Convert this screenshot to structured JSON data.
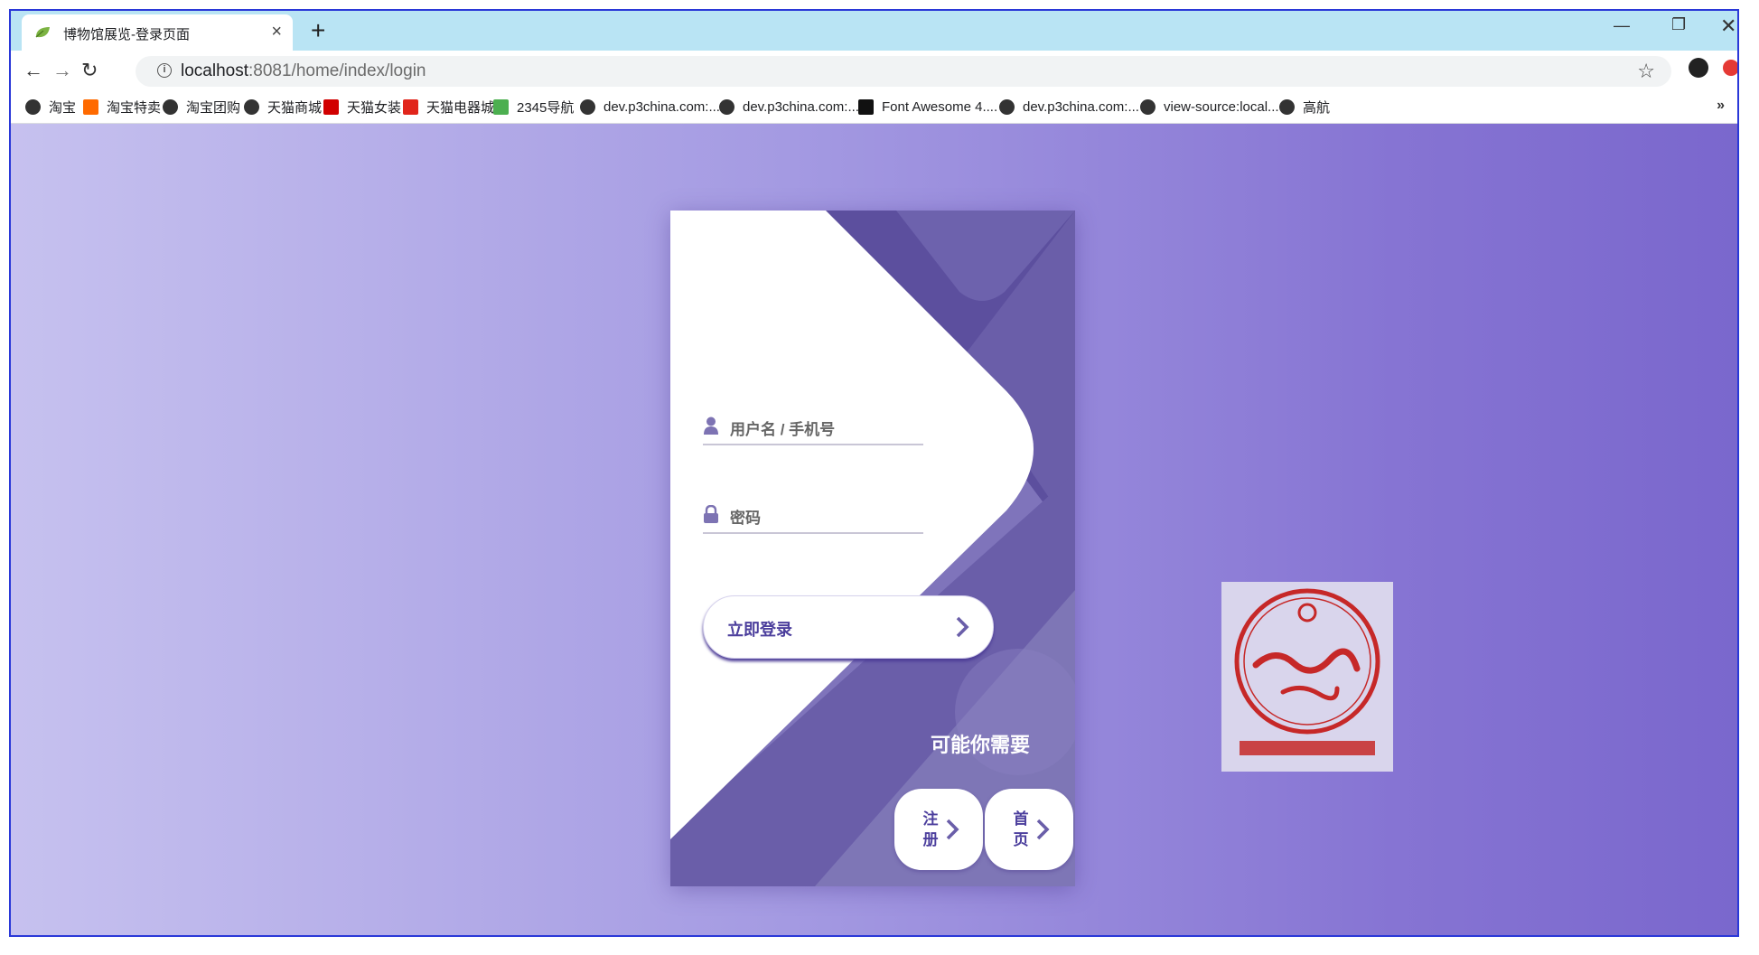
{
  "browser": {
    "tab_title": "博物馆展览-登录页面",
    "url_host": "localhost",
    "url_rest": ":8081/home/index/login",
    "bookmarks": [
      {
        "label": "淘宝",
        "icon": "globe-icon"
      },
      {
        "label": "淘宝特卖",
        "icon": "taobao-sale-icon"
      },
      {
        "label": "淘宝团购",
        "icon": "globe-icon"
      },
      {
        "label": "天猫商城",
        "icon": "globe-icon"
      },
      {
        "label": "天猫女装",
        "icon": "tmall-icon"
      },
      {
        "label": "天猫电器城",
        "icon": "jd-icon"
      },
      {
        "label": "2345导航",
        "icon": "house-icon"
      },
      {
        "label": "dev.p3china.com:...",
        "icon": "globe-icon"
      },
      {
        "label": "dev.p3china.com:...",
        "icon": "globe-icon"
      },
      {
        "label": "Font Awesome 4....",
        "icon": "flag-icon"
      },
      {
        "label": "dev.p3china.com:...",
        "icon": "globe-icon"
      },
      {
        "label": "view-source:local...",
        "icon": "globe-icon"
      },
      {
        "label": "高航",
        "icon": "globe-icon"
      }
    ]
  },
  "login": {
    "username_label": "用户名 / 手机号",
    "password_label": "密码",
    "login_button": "立即登录",
    "maybe_need": "可能你需要",
    "register_button": "注册",
    "home_button": "首页"
  },
  "colors": {
    "accent": "#4c3f9d",
    "card_purple": "#6a5ea9",
    "page_left": "#c6c1ef",
    "page_right": "#7a67cd"
  }
}
